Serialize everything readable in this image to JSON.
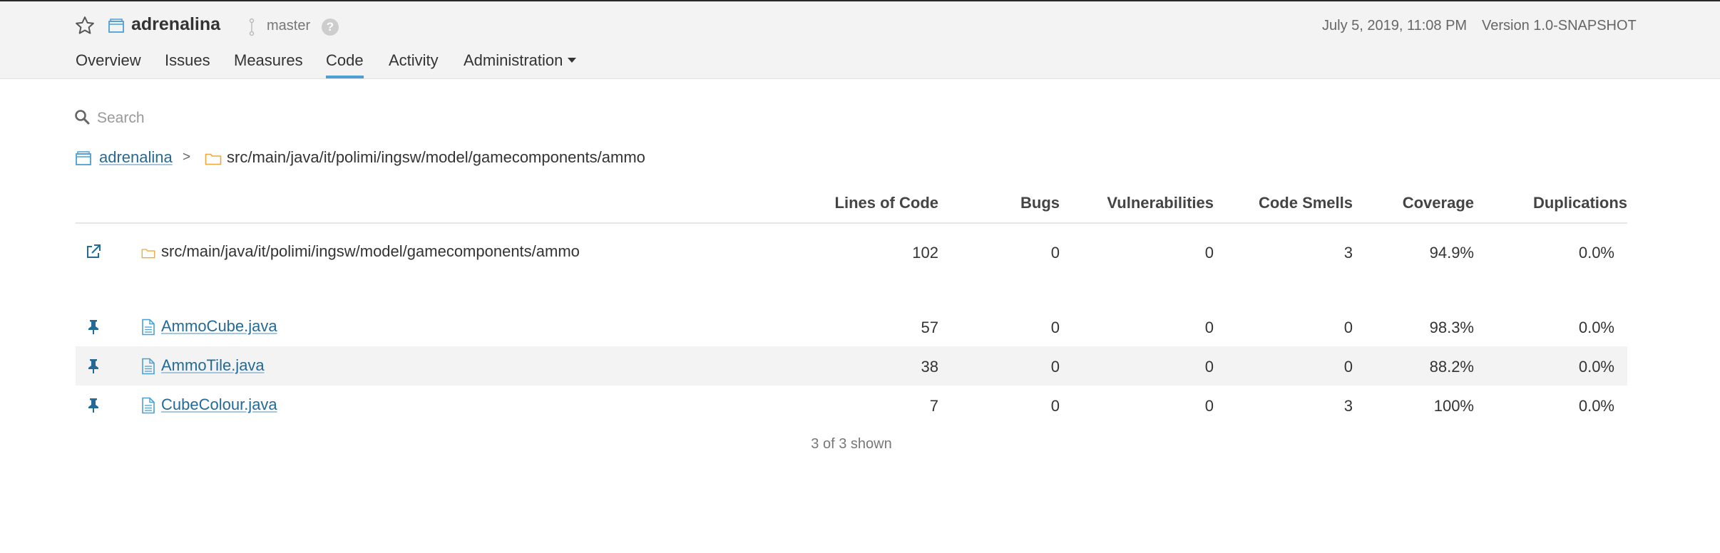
{
  "header": {
    "project_name": "adrenalina",
    "branch": "master",
    "help": "?",
    "date": "July 5, 2019, 11:08 PM",
    "version": "Version 1.0-SNAPSHOT",
    "icons": [
      "star-icon",
      "project-icon",
      "branch-icon",
      "help-icon"
    ]
  },
  "nav": {
    "items": [
      {
        "label": "Overview"
      },
      {
        "label": "Issues"
      },
      {
        "label": "Measures"
      },
      {
        "label": "Code",
        "active": true
      },
      {
        "label": "Activity"
      },
      {
        "label": "Administration",
        "dropdown": true
      }
    ]
  },
  "search": {
    "placeholder": "Search",
    "value": ""
  },
  "breadcrumb": {
    "project": "adrenalina",
    "separator": ">",
    "path": "src/main/java/it/polimi/ingsw/model/gamecomponents/ammo"
  },
  "table": {
    "columns": [
      "Lines of Code",
      "Bugs",
      "Vulnerabilities",
      "Code Smells",
      "Coverage",
      "Duplications"
    ],
    "directory_row": {
      "name": "src/main/java/it/polimi/ingsw/model/gamecomponents/ammo",
      "values": [
        "102",
        "0",
        "0",
        "3",
        "94.9%",
        "0.0%"
      ]
    },
    "files": [
      {
        "name": "AmmoCube.java",
        "values": [
          "57",
          "0",
          "0",
          "0",
          "98.3%",
          "0.0%"
        ]
      },
      {
        "name": "AmmoTile.java",
        "values": [
          "38",
          "0",
          "0",
          "0",
          "88.2%",
          "0.0%"
        ]
      },
      {
        "name": "CubeColour.java",
        "values": [
          "7",
          "0",
          "0",
          "3",
          "100%",
          "0.0%"
        ]
      }
    ],
    "shown_count": "3 of 3 shown"
  },
  "colors": {
    "accent": "#4b9fd5",
    "link": "#236a97",
    "folder": "#f0a63e",
    "header_bg": "#f3f3f3"
  }
}
